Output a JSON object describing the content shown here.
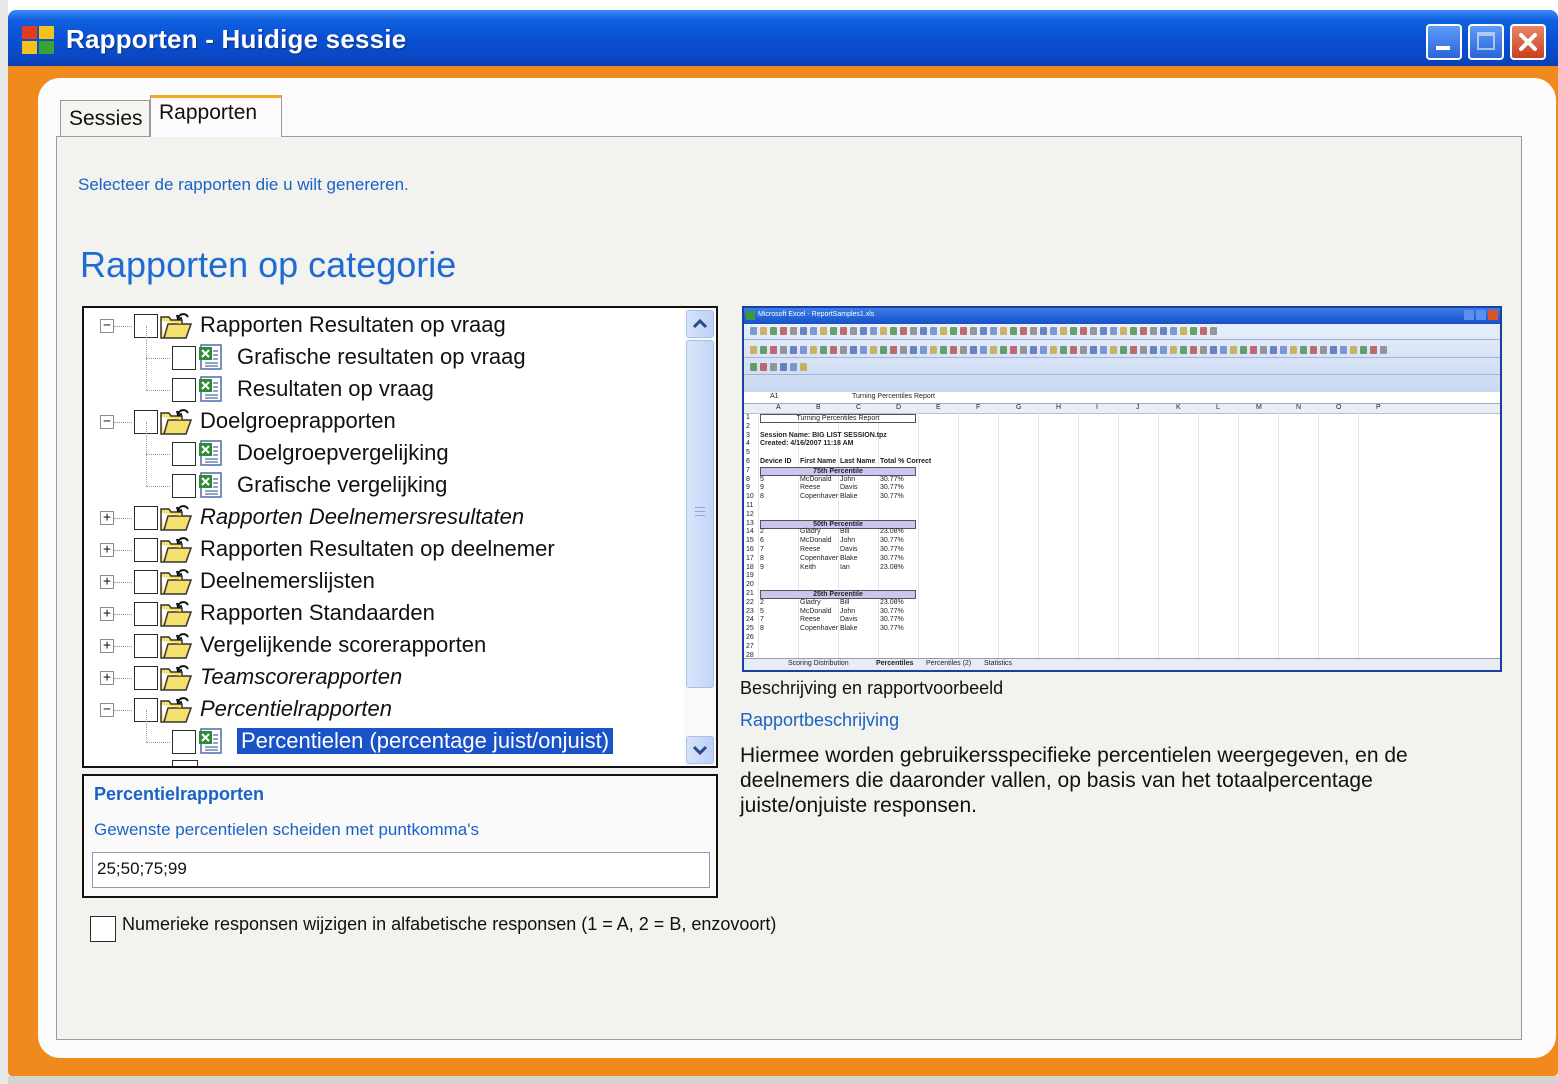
{
  "window": {
    "title": "Rapporten - Huidige sessie"
  },
  "tabs": [
    {
      "label": "Sessies",
      "active": false
    },
    {
      "label": "Rapporten",
      "active": true
    }
  ],
  "instruction": "Selecteer de rapporten die u wilt genereren.",
  "section_title": "Rapporten op categorie",
  "tree": [
    {
      "label": "Rapporten Resultaten op vraag",
      "level": 0,
      "expanded": true,
      "italic": false,
      "icon": "folder-icon"
    },
    {
      "label": "Grafische resultaten op vraag",
      "level": 1,
      "italic": false,
      "icon": "excel-report-icon"
    },
    {
      "label": "Resultaten op vraag",
      "level": 1,
      "italic": false,
      "icon": "excel-report-icon"
    },
    {
      "label": "Doelgroeprapporten",
      "level": 0,
      "expanded": true,
      "italic": false,
      "icon": "folder-icon"
    },
    {
      "label": "Doelgroepvergelijking",
      "level": 1,
      "italic": false,
      "icon": "excel-report-icon"
    },
    {
      "label": "Grafische vergelijking",
      "level": 1,
      "italic": false,
      "icon": "excel-report-icon"
    },
    {
      "label": "Rapporten Deelnemersresultaten",
      "level": 0,
      "expanded": false,
      "italic": true,
      "icon": "folder-icon"
    },
    {
      "label": "Rapporten Resultaten op deelnemer",
      "level": 0,
      "expanded": false,
      "italic": false,
      "icon": "folder-icon"
    },
    {
      "label": "Deelnemerslijsten",
      "level": 0,
      "expanded": false,
      "italic": false,
      "icon": "folder-icon"
    },
    {
      "label": "Rapporten Standaarden",
      "level": 0,
      "expanded": false,
      "italic": false,
      "icon": "folder-icon"
    },
    {
      "label": "Vergelijkende scorerapporten",
      "level": 0,
      "expanded": false,
      "italic": false,
      "icon": "folder-icon"
    },
    {
      "label": "Teamscorerapporten",
      "level": 0,
      "expanded": false,
      "italic": true,
      "icon": "folder-icon"
    },
    {
      "label": "Percentielrapporten",
      "level": 0,
      "expanded": true,
      "italic": true,
      "icon": "folder-icon"
    },
    {
      "label": "Percentielen (percentage juist/onjuist)",
      "level": 1,
      "italic": false,
      "icon": "excel-report-icon",
      "selected": true
    }
  ],
  "settings": {
    "title": "Percentielrapporten",
    "hint": "Gewenste percentielen scheiden met puntkomma's",
    "value": "25;50;75;99"
  },
  "numeric_option": {
    "label": "Numerieke responsen wijzigen in alfabetische responsen (1 = A, 2 = B, enzovoort)",
    "checked": false
  },
  "preview": {
    "caption": "Beschrijving en rapportvoorbeeld",
    "description_title": "Rapportbeschrijving",
    "description": "Hiermee worden gebruikersspecifieke percentielen weergegeven, en de deelnemers die daaronder vallen, op basis van het totaalpercentage juiste/onjuiste responsen.",
    "excel": {
      "title": "Microsoft Excel - ReportSamples1.xls",
      "cell_ref": "A1",
      "formula": "Turning Percentiles Report",
      "report_title": "Turning Percentiles Report",
      "session_name": "Session Name: BIG LIST SESSION.tpz",
      "created": "Created: 4/16/2007 11:18 AM",
      "headers": [
        "Device ID",
        "First Name",
        "Last Name",
        "Total % Correct"
      ],
      "groups": [
        {
          "name": "75th Percentile",
          "rows": [
            [
              "5",
              "McDonald",
              "John",
              "30.77%"
            ],
            [
              "9",
              "Reese",
              "Davis",
              "30.77%"
            ],
            [
              "8",
              "Copenhaver",
              "Blake",
              "30.77%"
            ]
          ]
        },
        {
          "name": "50th Percentile",
          "rows": [
            [
              "2",
              "Gladry",
              "Bill",
              "23.08%"
            ],
            [
              "6",
              "McDonald",
              "John",
              "30.77%"
            ],
            [
              "7",
              "Reese",
              "Davis",
              "30.77%"
            ],
            [
              "8",
              "Copenhaver",
              "Blake",
              "30.77%"
            ],
            [
              "9",
              "Keith",
              "Ian",
              "23.08%"
            ]
          ]
        },
        {
          "name": "25th Percentile",
          "rows": [
            [
              "2",
              "Gladry",
              "Bill",
              "23.08%"
            ],
            [
              "5",
              "McDonald",
              "John",
              "30.77%"
            ],
            [
              "7",
              "Reese",
              "Davis",
              "30.77%"
            ],
            [
              "8",
              "Copenhaver",
              "Blake",
              "30.77%"
            ]
          ]
        }
      ],
      "sheet_tabs": [
        "Scoring Distribution",
        "Percentiles",
        "Percentiles (2)",
        "Statistics"
      ]
    }
  },
  "colors": {
    "titlebar": "#0a4fd2",
    "frame": "#f08a1c",
    "link_blue": "#1a62c7",
    "selection": "#1a53c8"
  }
}
